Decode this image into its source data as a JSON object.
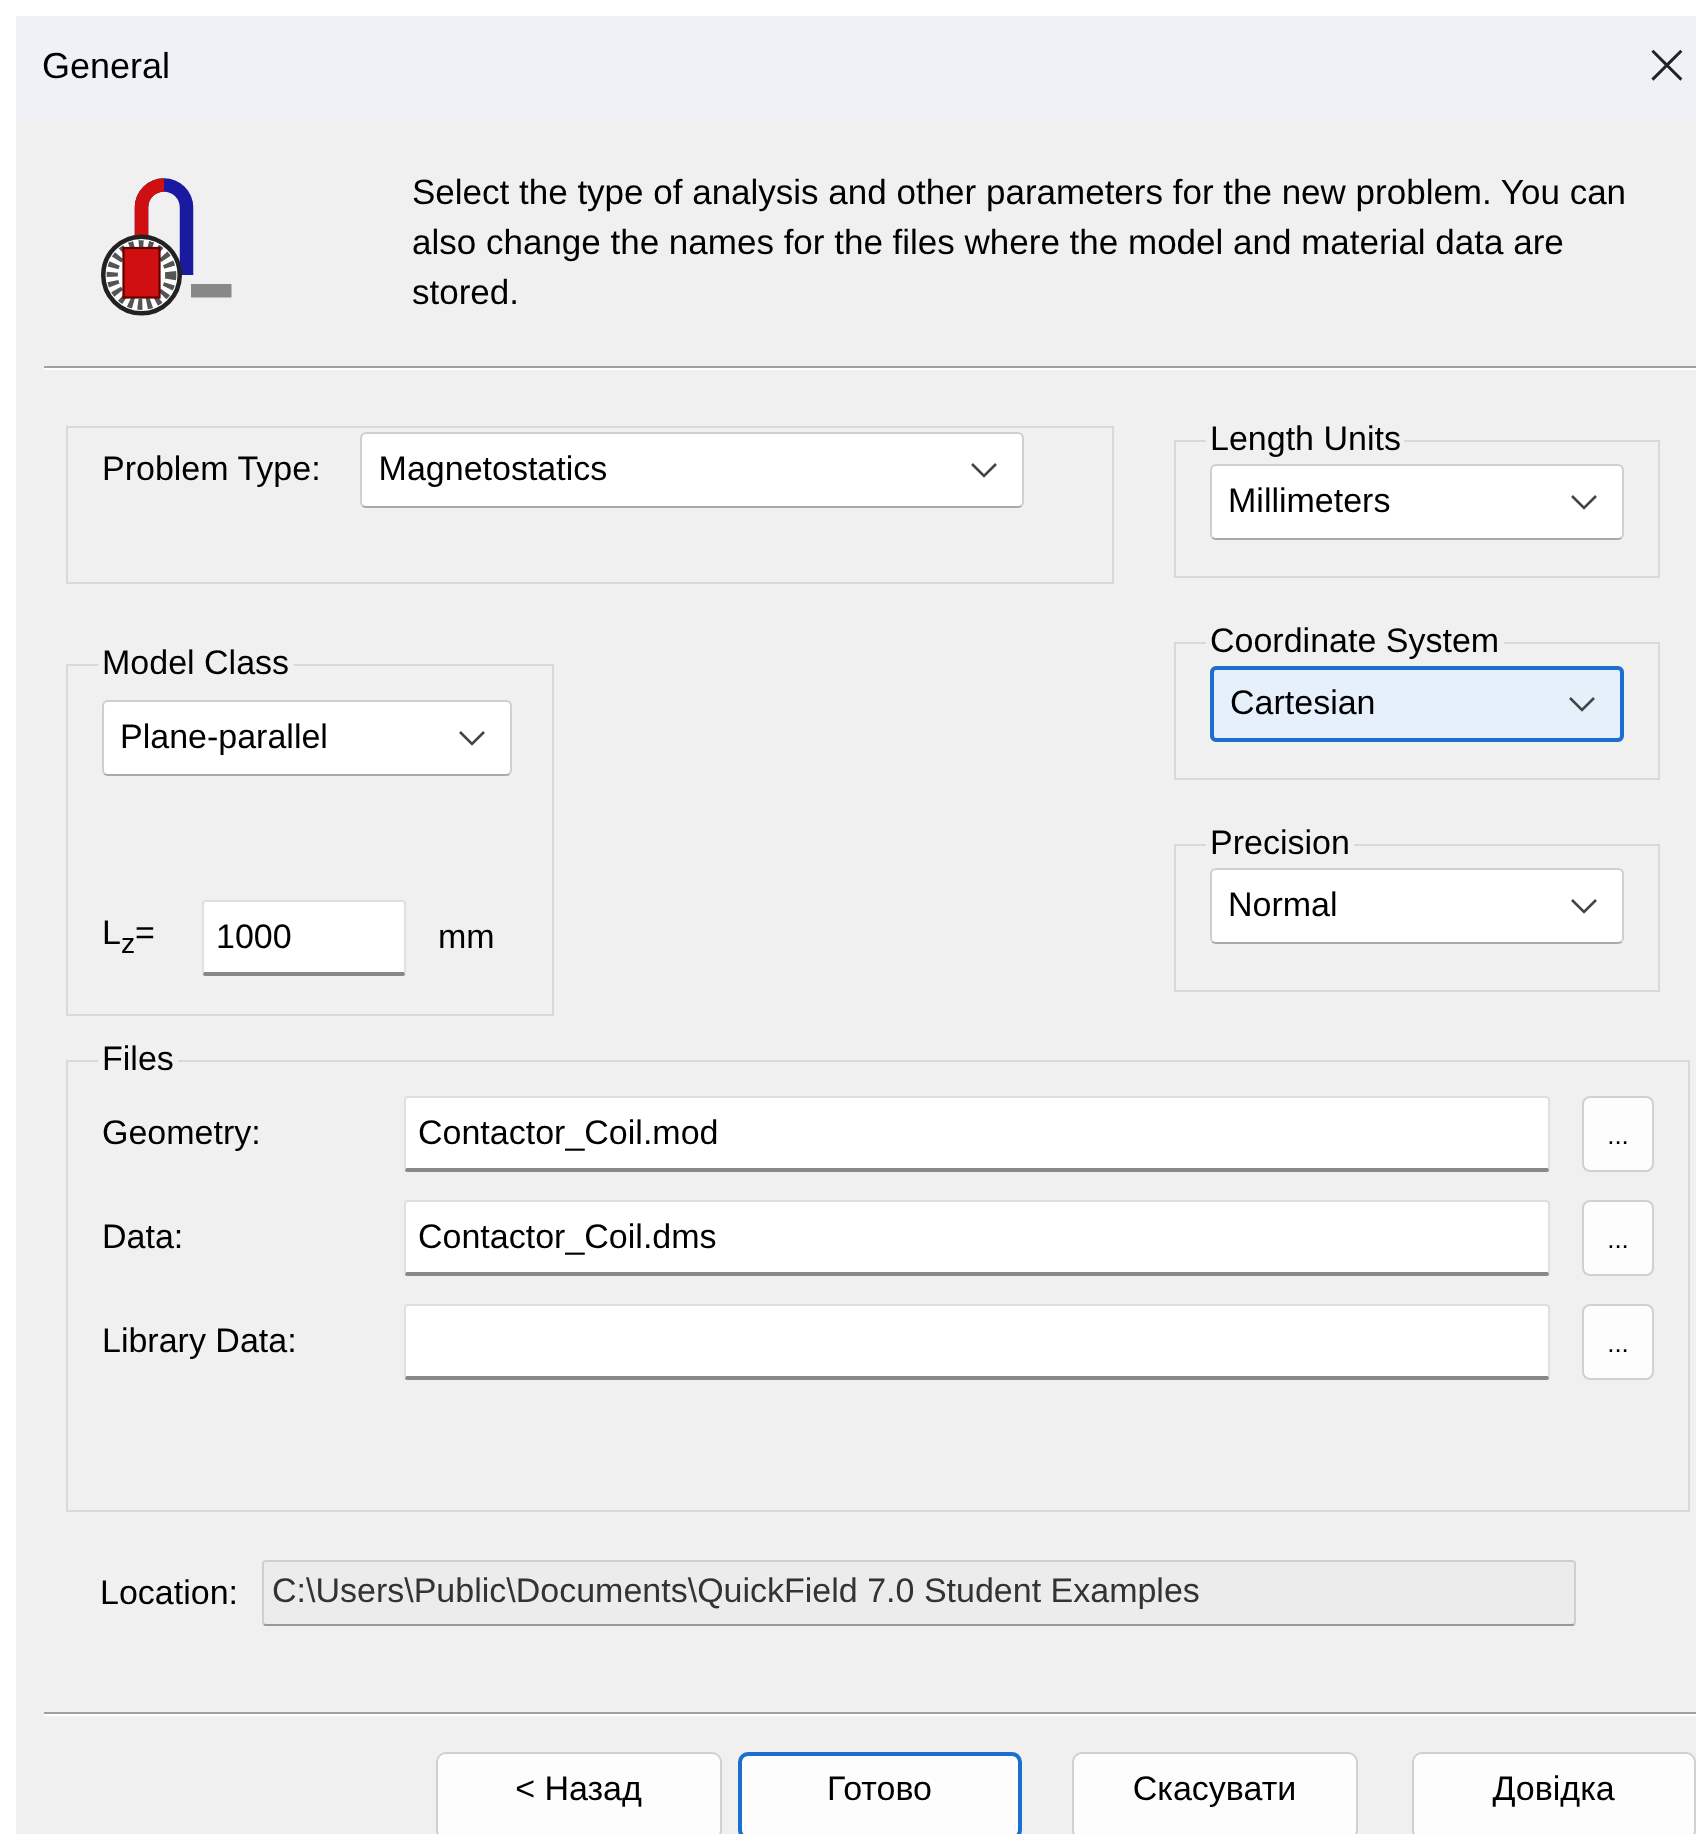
{
  "window": {
    "title": "General",
    "close": "×"
  },
  "header": {
    "description": "Select the type of analysis and other parameters for the new problem. You can also change the names for the files where the model and material data are stored."
  },
  "problem_type": {
    "label": "Problem Type:",
    "value": "Magnetostatics",
    "focused": false
  },
  "length_units": {
    "legend": "Length Units",
    "value": "Millimeters",
    "focused": false
  },
  "model_class": {
    "legend": "Model Class",
    "value": "Plane-parallel",
    "focused": false,
    "lz_label": "L$_{z}$=",
    "lz_value": "1000",
    "lz_unit": "mm"
  },
  "coordinate_system": {
    "legend": "Coordinate System",
    "value": "Cartesian",
    "focused": true
  },
  "precision": {
    "legend": "Precision",
    "value": "Normal",
    "focused": false
  },
  "files": {
    "legend": "Files",
    "rows": [
      {
        "label": "Geometry:",
        "value": "Contactor_Coil.mod",
        "browse": "..."
      },
      {
        "label": "Data:",
        "value": "Contactor_Coil.dms",
        "browse": "..."
      },
      {
        "label": "Library Data:",
        "value": "",
        "browse": "..."
      }
    ]
  },
  "location": {
    "label": "Location:",
    "value": "C:\\Users\\Public\\Documents\\QuickField 7.0 Student Examples",
    "disabled": true
  },
  "buttons": [
    {
      "label": "< Назад",
      "default": false
    },
    {
      "label": "Готово",
      "default": true
    },
    {
      "label": "Скасувати",
      "default": false
    },
    {
      "label": "Довідка",
      "default": false
    }
  ]
}
